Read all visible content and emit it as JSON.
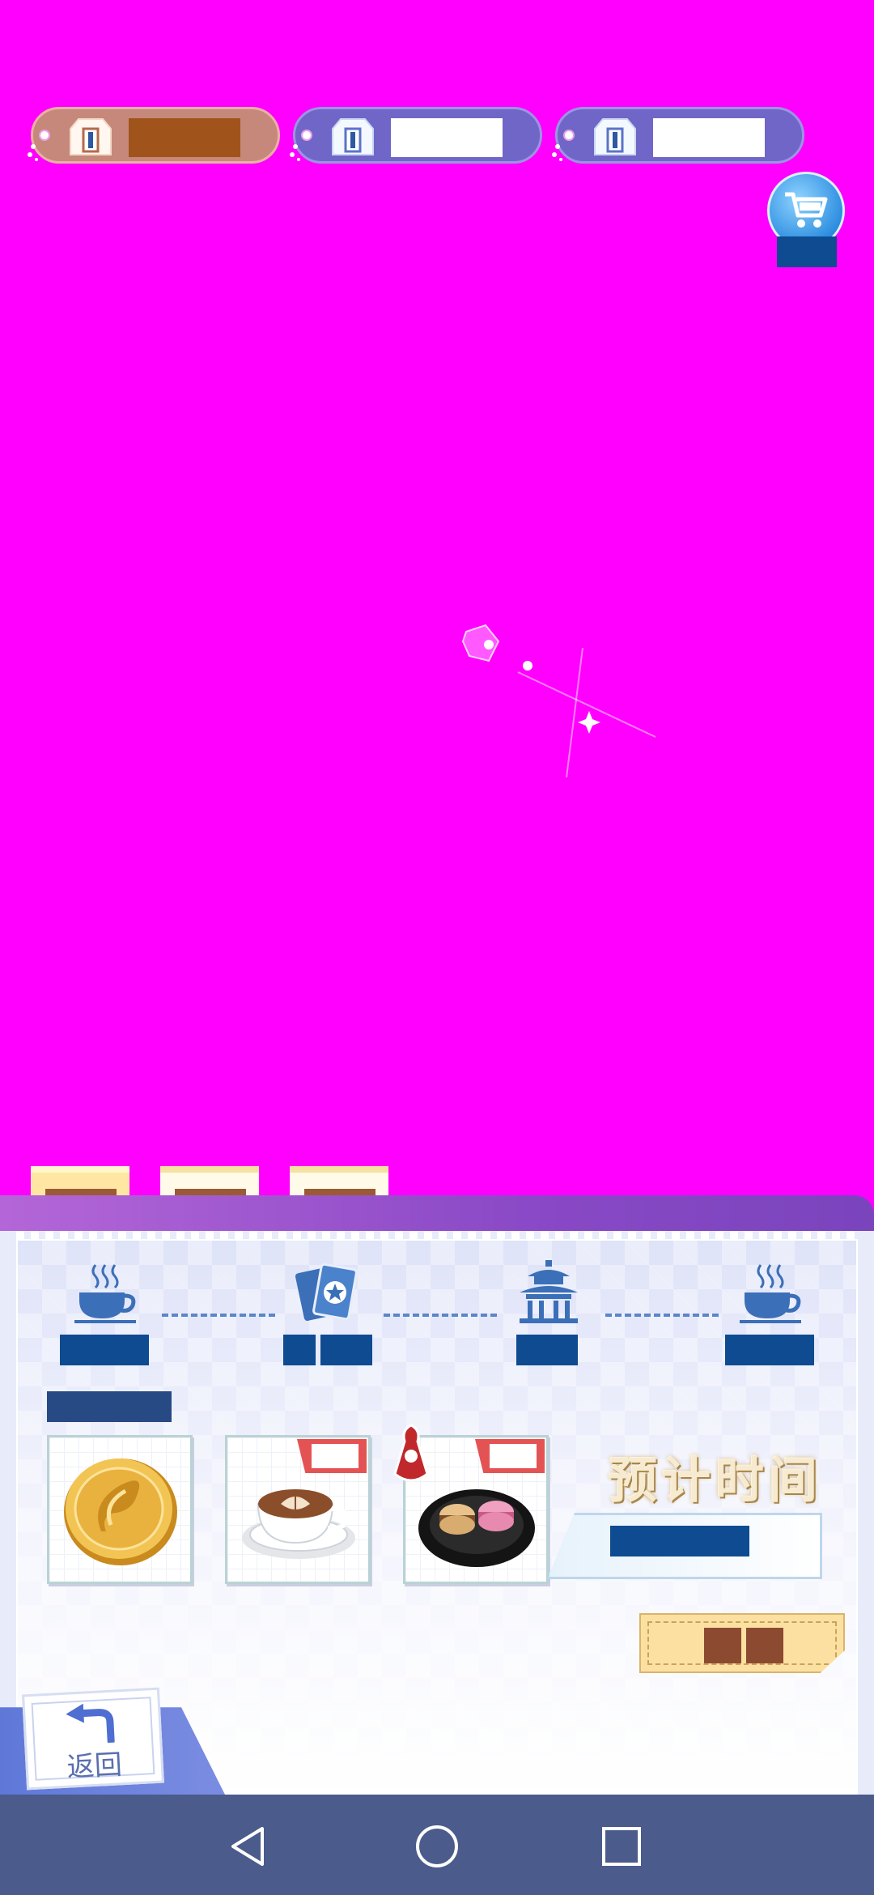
{
  "currencies": [
    {
      "icon": "gem-box-icon",
      "value": ""
    },
    {
      "icon": "gem-box-icon",
      "value": ""
    },
    {
      "icon": "gem-box-icon",
      "value": ""
    }
  ],
  "shop": {
    "icon": "shopping-cart-icon",
    "label": ""
  },
  "tabs": [
    {
      "label": "",
      "active": true
    },
    {
      "label": "",
      "active": false
    },
    {
      "label": "",
      "active": false
    }
  ],
  "route": {
    "nodes": [
      {
        "icon": "coffee-cup-icon",
        "label": ""
      },
      {
        "icon": "cards-icon",
        "label": ""
      },
      {
        "icon": "pavilion-icon",
        "label": ""
      },
      {
        "icon": "coffee-cup-icon",
        "label": ""
      }
    ],
    "status": ""
  },
  "items": [
    {
      "name": "coin",
      "icon": "gold-coin-icon",
      "badge": null
    },
    {
      "name": "latte",
      "icon": "latte-icon",
      "badge": ""
    },
    {
      "name": "macarons",
      "icon": "macarons-icon",
      "badge": ""
    }
  ],
  "estimate": {
    "title": "预计时间",
    "value": ""
  },
  "confirm": {
    "label": ""
  },
  "back": {
    "label": "返回"
  },
  "colors": {
    "background": "#ff00ff",
    "panel": "#e8ebfa",
    "accent_blue": "#0e4b91",
    "purple_header": "#8a49c6",
    "navbar": "#4a5b8c"
  }
}
